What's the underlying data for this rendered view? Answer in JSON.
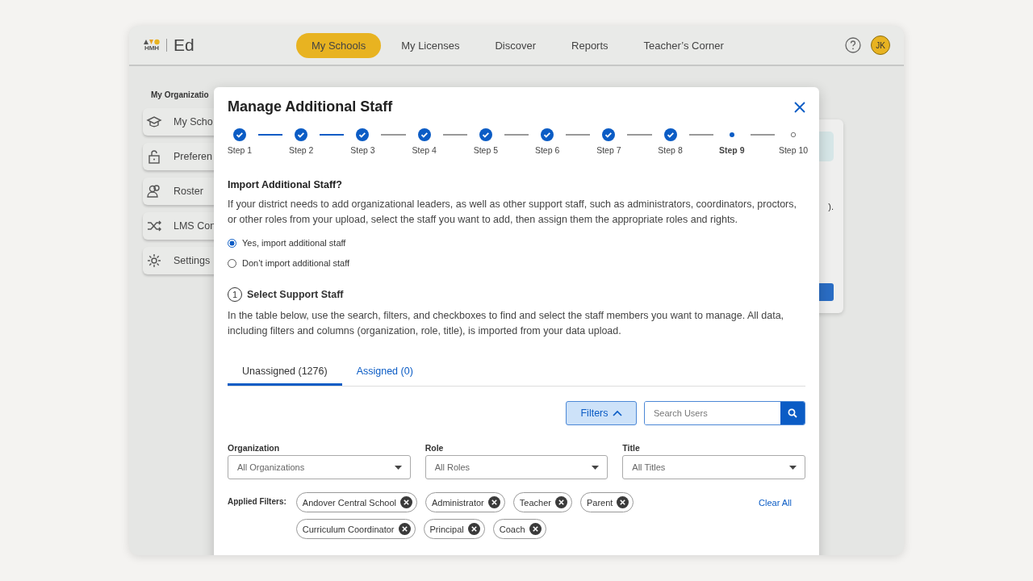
{
  "header": {
    "logo_mark": "HMH",
    "logo_text": "Ed",
    "nav": [
      {
        "label": "My Schools",
        "selected": true
      },
      {
        "label": "My Licenses",
        "selected": false
      },
      {
        "label": "Discover",
        "selected": false
      },
      {
        "label": "Reports",
        "selected": false
      },
      {
        "label": "Teacher’s Corner",
        "selected": false
      }
    ],
    "avatar": "JK"
  },
  "sidebar": {
    "title": "My Organizatio",
    "items": [
      {
        "label": "My Scho",
        "kind": "school"
      },
      {
        "label": "Preferen",
        "kind": "lock"
      },
      {
        "label": "Roster",
        "kind": "people"
      },
      {
        "label": "LMS Con",
        "kind": "shuffle"
      },
      {
        "label": "Settings",
        "kind": "gear"
      }
    ]
  },
  "background_card": {
    "text": ")."
  },
  "modal": {
    "title": "Manage Additional Staff",
    "steps": [
      {
        "label": "Step 1",
        "completed": true,
        "current": false
      },
      {
        "label": "Step 2",
        "completed": true,
        "current": false
      },
      {
        "label": "Step 3",
        "completed": true,
        "current": false
      },
      {
        "label": "Step 4",
        "completed": true,
        "current": false
      },
      {
        "label": "Step 5",
        "completed": true,
        "current": false
      },
      {
        "label": "Step 6",
        "completed": true,
        "current": false
      },
      {
        "label": "Step 7",
        "completed": true,
        "current": false
      },
      {
        "label": "Step 8",
        "completed": true,
        "current": false
      },
      {
        "label": "Step 9",
        "completed": false,
        "current": true
      },
      {
        "label": "Step 10",
        "completed": false,
        "current": false
      }
    ],
    "connectors": [
      {
        "highlighted": true
      },
      {
        "highlighted": true
      },
      {
        "highlighted": false
      },
      {
        "highlighted": false
      },
      {
        "highlighted": false
      },
      {
        "highlighted": false
      },
      {
        "highlighted": false
      },
      {
        "highlighted": false
      },
      {
        "highlighted": false
      }
    ],
    "question": "Import Additional Staff?",
    "description": "If your district needs to add organizational leaders, as well as other support staff, such as administrators, coordinators, proctors, or other roles from your upload, select the staff you want to add, then assign them the appropriate roles and rights.",
    "options": [
      {
        "label": "Yes, import additional staff",
        "selected": true
      },
      {
        "label": "Don’t import additional staff",
        "selected": false
      }
    ],
    "section": {
      "number": "1",
      "title": "Select Support Staff",
      "text": "In the table below, use the search, filters, and checkboxes to find and select the staff members you want to manage. All data, including filters and columns (organization, role, title), is imported from your data upload."
    },
    "tabs": [
      {
        "label": "Unassigned (1276)",
        "selected": true
      },
      {
        "label": "Assigned (0)",
        "selected": false
      }
    ],
    "filters_button": {
      "label": "Filters",
      "expanded": true
    },
    "search": {
      "placeholder": "Search Users"
    },
    "dropdowns": [
      {
        "label": "Organization",
        "value": "All Organizations"
      },
      {
        "label": "Role",
        "value": "All Roles"
      },
      {
        "label": "Title",
        "value": "All Titles"
      }
    ],
    "applied_filters": {
      "label": "Applied Filters:",
      "clear": "Clear All",
      "chips": [
        [
          "Andover Central School",
          "Administrator",
          "Teacher",
          "Parent"
        ],
        [
          "Curriculum Coordinator",
          "Principal",
          "Coach"
        ]
      ]
    }
  }
}
